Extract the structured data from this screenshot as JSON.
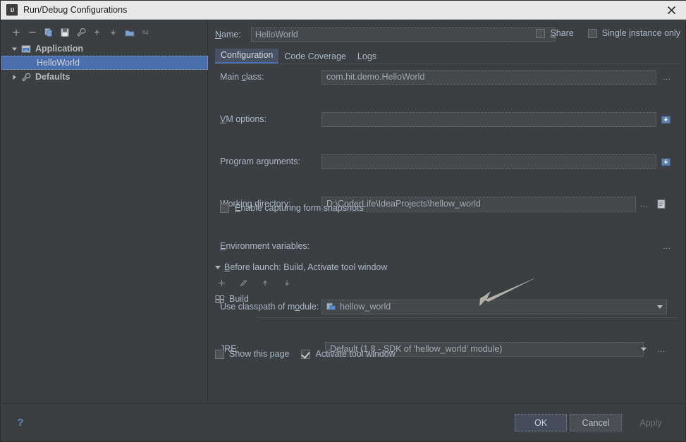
{
  "window": {
    "title": "Run/Debug Configurations",
    "title_icon": "intellij-idea-icon",
    "close_icon": "close-icon"
  },
  "left_panel": {
    "toolbar": [
      {
        "name": "add-configuration-button",
        "icon": "plus-icon",
        "label": "+"
      },
      {
        "name": "remove-configuration-button",
        "icon": "minus-icon",
        "label": "−"
      },
      {
        "name": "copy-configuration-button",
        "icon": "copy-icon",
        "label": ""
      },
      {
        "name": "save-configuration-button",
        "icon": "save-icon",
        "label": ""
      },
      {
        "name": "edit-defaults-button",
        "icon": "wrench-icon",
        "label": ""
      },
      {
        "name": "move-up-button",
        "icon": "arrow-up-icon",
        "label": ""
      },
      {
        "name": "move-down-button",
        "icon": "arrow-down-icon",
        "label": ""
      },
      {
        "name": "create-folder-button",
        "icon": "folder-icon",
        "label": ""
      },
      {
        "name": "sort-configurations-button",
        "icon": "sort-icon",
        "label": ""
      }
    ],
    "tree": [
      {
        "label": "Application",
        "icon": "application-icon",
        "expanded": true,
        "selected": false,
        "level": 0
      },
      {
        "label": "HelloWorld",
        "icon": "",
        "expanded": false,
        "selected": true,
        "level": 1
      },
      {
        "label": "Defaults",
        "icon": "defaults-icon",
        "expanded": false,
        "selected": false,
        "level": 0
      }
    ]
  },
  "right_pane": {
    "name_label": "Name:",
    "name_mnemonic": "N",
    "name_value": "HelloWorld",
    "share": {
      "label": "Share",
      "mnemonic": "S",
      "checked": false
    },
    "single_instance": {
      "label": "Single instance only",
      "mnemonic": "i",
      "checked": false
    },
    "tabs": [
      {
        "label": "Configuration",
        "active": true
      },
      {
        "label": "Code Coverage",
        "active": false
      },
      {
        "label": "Logs",
        "active": false
      }
    ],
    "fields": {
      "main_class": {
        "label": "Main class:",
        "mnemonic": "c",
        "value": "com.hit.demo.HelloWorld",
        "browse": "..."
      },
      "vm_options": {
        "label": "VM options:",
        "mnemonic": "V",
        "value": "",
        "expand_icon": "expand-editor-icon"
      },
      "program_arguments": {
        "label": "Program arguments:",
        "mnemonic": "g",
        "value": "",
        "expand_icon": "expand-editor-icon"
      },
      "working_directory": {
        "label": "Working directory:",
        "mnemonic": "W",
        "value": "D:\\CoderLife\\IdeaProjects\\hellow_world",
        "browse": "...",
        "macro_icon": "insert-macro-icon"
      },
      "environment_variables": {
        "label": "Environment variables:",
        "mnemonic": "E",
        "value": "",
        "browse": "..."
      },
      "use_classpath": {
        "label": "Use classpath of module:",
        "mnemonic": "o",
        "value": "hellow_world",
        "value_icon": "module-icon"
      },
      "jre": {
        "label": "JRE:",
        "mnemonic": "J",
        "value": "Default (1.8 - SDK of 'hellow_world' module)",
        "browse": "..."
      }
    },
    "form_snapshots": {
      "label": "Enable capturing form snapshots",
      "mnemonic": "E",
      "checked": false
    },
    "before_launch": {
      "header": "Before launch: Build, Activate tool window",
      "mnemonic": "B",
      "expanded": true,
      "toolbar": [
        {
          "name": "add-before-launch-task-button",
          "icon": "plus-icon"
        },
        {
          "name": "edit-before-launch-task-button",
          "icon": "pencil-icon"
        },
        {
          "name": "move-task-up-button",
          "icon": "arrow-up-icon"
        },
        {
          "name": "move-task-down-button",
          "icon": "arrow-down-icon"
        }
      ],
      "items": [
        {
          "label": "Build",
          "icon": "build-icon"
        }
      ]
    },
    "bottom_checks": [
      {
        "name": "show-this-page-checkbox",
        "label": "Show this page",
        "checked": false
      },
      {
        "name": "activate-tool-window-checkbox",
        "label": "Activate tool window",
        "checked": true
      }
    ]
  },
  "bottom_bar": {
    "help_icon": "help-question-icon",
    "buttons": [
      {
        "name": "ok-button",
        "label": "OK",
        "style": "default",
        "enabled": true
      },
      {
        "name": "cancel-button",
        "label": "Cancel",
        "style": "cancel",
        "enabled": true
      },
      {
        "name": "apply-button",
        "label": "Apply",
        "style": "disabled",
        "enabled": false
      }
    ]
  },
  "annotation": {
    "arrow_icon": "pointer-arrow-annotation"
  },
  "colors": {
    "background": "#3c3f41",
    "field_background": "#45484a",
    "text": "#a9b7c6",
    "selection": "#4b6eaf",
    "titlebar": "#e8e8e8",
    "accent": "#4b6eaf"
  }
}
